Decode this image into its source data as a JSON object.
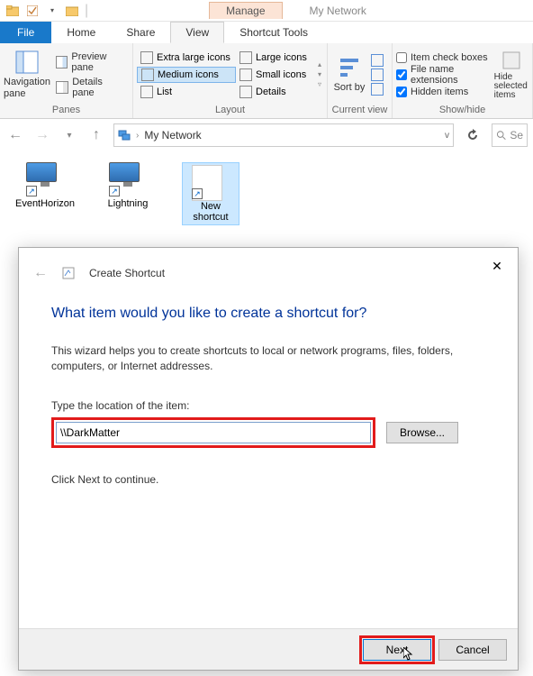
{
  "titlebar": {
    "context_tab": "Manage",
    "window_title": "My Network"
  },
  "tabs": {
    "file": "File",
    "home": "Home",
    "share": "Share",
    "view": "View",
    "shortcut_tools": "Shortcut Tools"
  },
  "ribbon": {
    "panes": {
      "nav_pane": "Navigation pane",
      "preview_pane": "Preview pane",
      "details_pane": "Details pane",
      "group_label": "Panes"
    },
    "layout": {
      "xl_icons": "Extra large icons",
      "large_icons": "Large icons",
      "medium_icons": "Medium icons",
      "small_icons": "Small icons",
      "list": "List",
      "details": "Details",
      "group_label": "Layout"
    },
    "current_view": {
      "sort_by": "Sort by",
      "group_label": "Current view"
    },
    "showhide": {
      "item_check": "Item check boxes",
      "file_ext": "File name extensions",
      "hidden": "Hidden items",
      "hide_sel": "Hide selected items",
      "group_label": "Show/hide"
    }
  },
  "address": {
    "path": "My Network",
    "search_placeholder": "Se"
  },
  "items": [
    {
      "name": "EventHorizon"
    },
    {
      "name": "Lightning"
    },
    {
      "name": "New shortcut"
    }
  ],
  "wizard": {
    "small_title": "Create Shortcut",
    "heading": "What item would you like to create a shortcut for?",
    "description": "This wizard helps you to create shortcuts to local or network programs, files, folders, computers, or Internet addresses.",
    "location_label": "Type the location of the item:",
    "location_value": "\\\\DarkMatter",
    "browse": "Browse...",
    "continue_hint": "Click Next to continue.",
    "next": "Next",
    "cancel": "Cancel"
  }
}
